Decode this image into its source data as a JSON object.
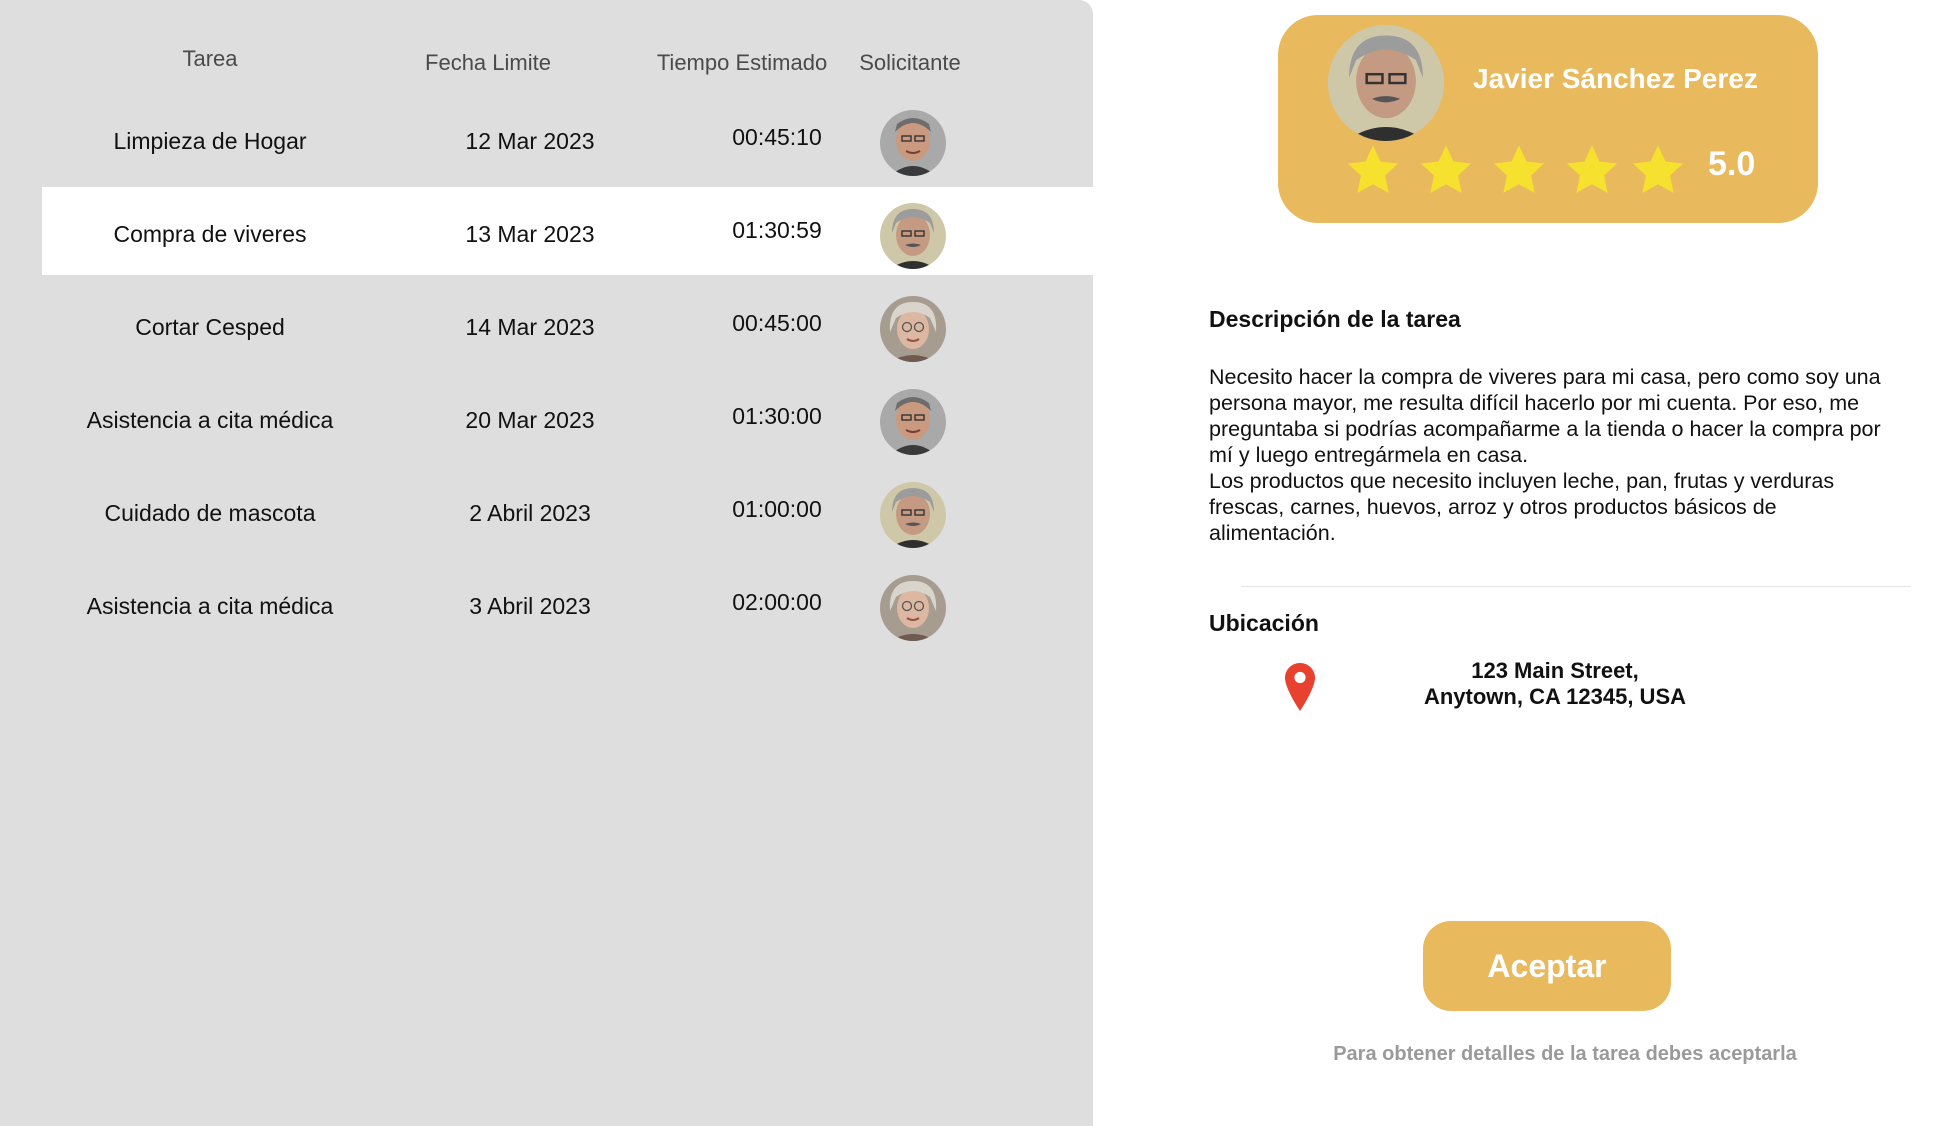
{
  "table": {
    "headers": {
      "task": "Tarea",
      "deadline": "Fecha Limite",
      "estimated_time": "Tiempo Estimado",
      "requester": "Solicitante"
    },
    "rows": [
      {
        "task": "Limpieza de Hogar",
        "deadline": "12 Mar 2023",
        "time": "00:45:10",
        "avatar": "man-avatar-1"
      },
      {
        "task": "Compra de viveres",
        "deadline": "13 Mar 2023",
        "time": "01:30:59",
        "avatar": "man-avatar-2",
        "selected": true
      },
      {
        "task": "Cortar Cesped",
        "deadline": "14 Mar 2023",
        "time": "00:45:00",
        "avatar": "woman-avatar"
      },
      {
        "task": "Asistencia a cita médica",
        "deadline": "20 Mar 2023",
        "time": "01:30:00",
        "avatar": "man-avatar-1"
      },
      {
        "task": "Cuidado de mascota",
        "deadline": "2 Abril 2023",
        "time": "01:00:00",
        "avatar": "man-avatar-2"
      },
      {
        "task": "Asistencia a cita médica",
        "deadline": "3 Abril 2023",
        "time": "02:00:00",
        "avatar": "woman-avatar"
      }
    ]
  },
  "profile": {
    "name": "Javier Sánchez Perez",
    "rating": "5.0",
    "stars": 5
  },
  "details": {
    "description_title": "Descripción de la tarea",
    "description_paragraphs": [
      "Necesito hacer la compra de viveres para mi casa, pero como soy una persona mayor, me resulta difícil hacerlo por mi cuenta. Por eso, me preguntaba si podrías acompañarme a la tienda o hacer la compra por mí y luego entregármela en casa.",
      "Los productos que necesito incluyen leche, pan, frutas y verduras frescas, carnes, huevos, arroz y otros productos básicos de alimentación."
    ],
    "location_title": "Ubicación",
    "address_line1": "123 Main Street,",
    "address_line2": "Anytown, CA 12345, USA"
  },
  "actions": {
    "accept_label": "Aceptar",
    "hint": "Para obtener detalles de la tarea debes aceptarla"
  },
  "colors": {
    "accent": "#e8b95d",
    "star": "#f6e12f",
    "pin": "#e8412f",
    "panel_bg": "#dedede"
  },
  "icons": {
    "location": "map-pin-icon",
    "rating": "star-icon"
  }
}
